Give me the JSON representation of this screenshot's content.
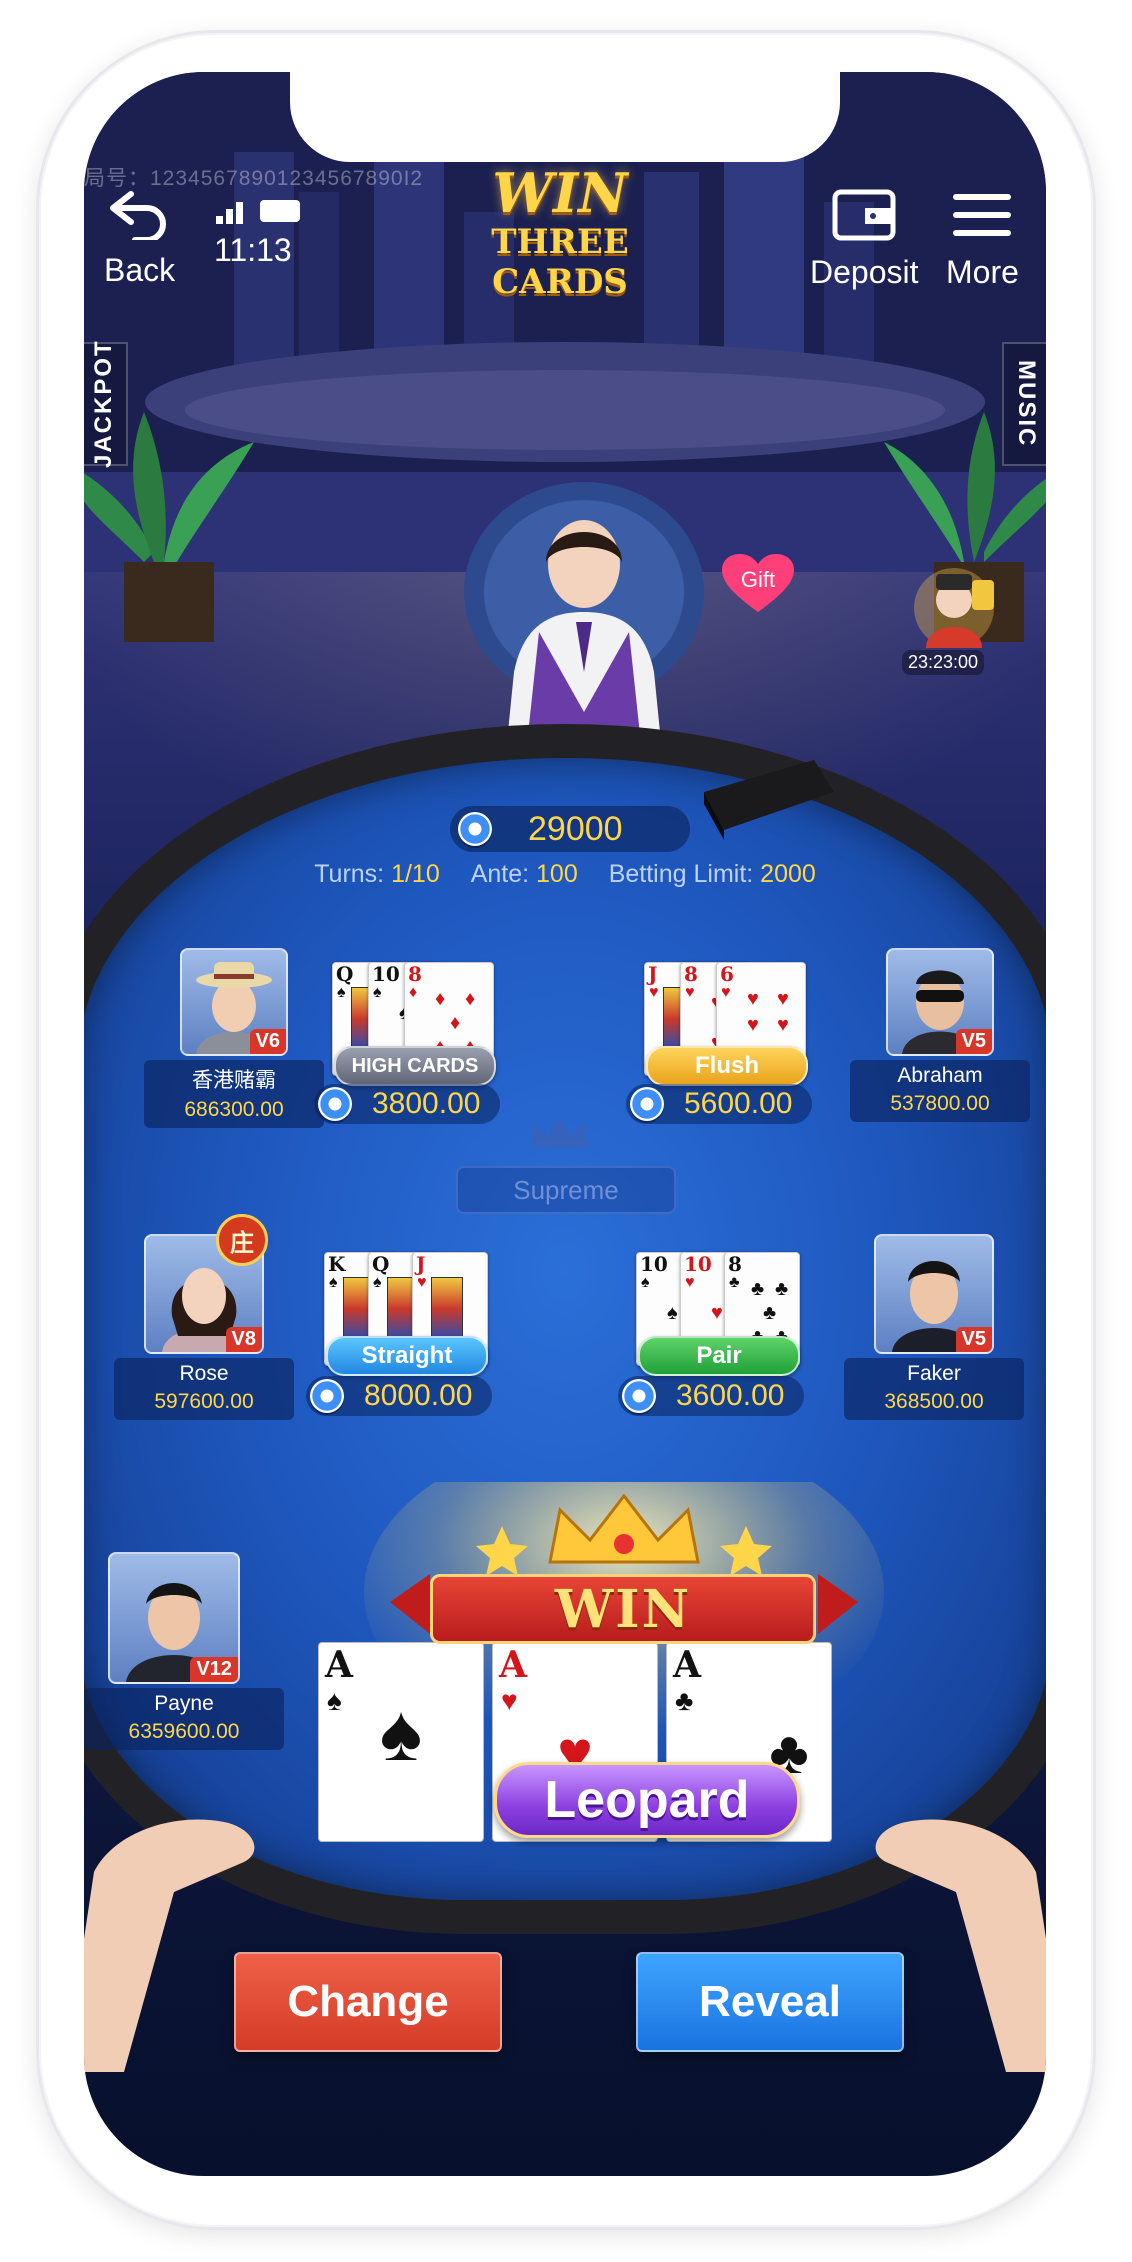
{
  "header": {
    "table_id": "局号：12345678901234567890I2",
    "back_label": "Back",
    "time": "11:13",
    "deposit_label": "Deposit",
    "more_label": "More"
  },
  "logo": {
    "line1": "WIN",
    "line2": "THREE CARDS"
  },
  "side_tabs": {
    "left": "JACKPOT",
    "right": "MUSIC"
  },
  "gift_label": "Gift",
  "event_timer": "23:23:00",
  "pot": "29000",
  "table_info": {
    "turns_label": "Turns:",
    "turns_value": "1/10",
    "ante_label": "Ante:",
    "ante_value": "100",
    "limit_label": "Betting Limit:",
    "limit_value": "2000"
  },
  "supreme_label": "Supreme",
  "dealer_mark": "庄",
  "players": {
    "p1": {
      "name": "香港赌霸",
      "money": "686300.00",
      "vip": "V6"
    },
    "p2": {
      "name": "Abraham",
      "money": "537800.00",
      "vip": "V5"
    },
    "p3": {
      "name": "Rose",
      "money": "597600.00",
      "vip": "V8"
    },
    "p4": {
      "name": "Faker",
      "money": "368500.00",
      "vip": "V5"
    },
    "p5": {
      "name": "Payne",
      "money": "6359600.00",
      "vip": "V12"
    }
  },
  "hands": {
    "h1": {
      "label": "HIGH CARDS",
      "bet": "3800.00",
      "cards": [
        {
          "r": "Q",
          "s": "♠"
        },
        {
          "r": "10",
          "s": "♠"
        },
        {
          "r": "8",
          "s": "♦"
        }
      ]
    },
    "h2": {
      "label": "Flush",
      "bet": "5600.00",
      "cards": [
        {
          "r": "J",
          "s": "♥"
        },
        {
          "r": "8",
          "s": "♥"
        },
        {
          "r": "6",
          "s": "♥"
        }
      ]
    },
    "h3": {
      "label": "Straight",
      "bet": "8000.00",
      "cards": [
        {
          "r": "K",
          "s": "♠"
        },
        {
          "r": "Q",
          "s": "♠"
        },
        {
          "r": "J",
          "s": "♥"
        }
      ]
    },
    "h4": {
      "label": "Pair",
      "bet": "3600.00",
      "cards": [
        {
          "r": "10",
          "s": "♠"
        },
        {
          "r": "10",
          "s": "♥"
        },
        {
          "r": "8",
          "s": "♣"
        }
      ]
    }
  },
  "win": {
    "banner": "WIN",
    "hand_label": "Leopard",
    "cards": [
      {
        "r": "A",
        "s": "♠"
      },
      {
        "r": "A",
        "s": "♥"
      },
      {
        "r": "A",
        "s": "♣"
      }
    ]
  },
  "actions": {
    "change_label": "Change",
    "reveal_label": "Reveal"
  },
  "colors": {
    "gold": "#ffd54a",
    "felt": "#1f59c0",
    "change": "#e04a34",
    "reveal": "#2288f0"
  }
}
